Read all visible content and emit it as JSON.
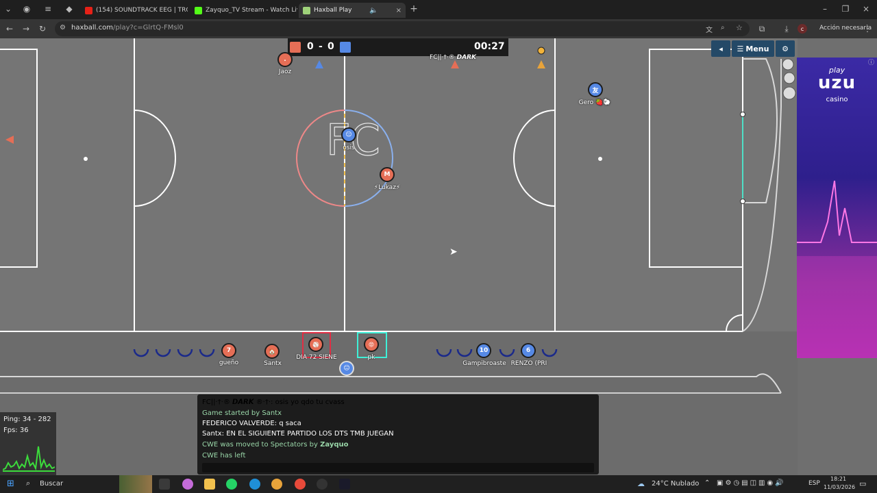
{
  "browser": {
    "tabs": [
      {
        "title": "(154) SOUNDTRACK EEG | TRO",
        "favicon_color": "#e62117"
      },
      {
        "title": "Zayquo_TV Stream - Watch Liv",
        "favicon_color": "#53fc18"
      },
      {
        "title": "Haxball Play",
        "favicon_color": "#9fd27a"
      }
    ],
    "url_host": "haxball.com",
    "url_path": "/play?c=GlrtQ-FMsl0",
    "profile_action": "Acción necesaria"
  },
  "scoreboard": {
    "red_score": "0",
    "separator": "-",
    "blue_score": "0",
    "time": "00:27",
    "red_color": "#e56e56",
    "blue_color": "#5689e5"
  },
  "menu": {
    "back_icon": "◂",
    "menu_label": "Menu",
    "gear_icon": "⚙"
  },
  "field": {
    "floor_text": "FC",
    "players_on_field": [
      {
        "name": "Jaoz",
        "team": "red",
        "avatar": "."
      },
      {
        "name": "FC||·†·® 𝘿𝘼𝙍𝙆",
        "team": "red",
        "avatar": ""
      },
      {
        "name": "Gero 🍓🐑",
        "team": "blue",
        "avatar": "友"
      },
      {
        "name": "osis",
        "team": "blue",
        "avatar": "😑"
      },
      {
        "name": "⚡Lukaz⚡",
        "team": "red",
        "avatar": "M"
      }
    ],
    "bench_red": [
      {
        "name": "gueño",
        "avatar": "7"
      },
      {
        "name": "Santx",
        "avatar": "🏠"
      },
      {
        "name": "DIA 72 SIENE",
        "avatar": "⚾"
      },
      {
        "name": "pk",
        "avatar": "😡"
      }
    ],
    "bench_blue": [
      {
        "name": "Gampibroaste",
        "avatar": "10"
      },
      {
        "name": "RENZO (PRI",
        "avatar": "6"
      }
    ],
    "spectator_avatar": "😑"
  },
  "ad": {
    "brand_line1": "play",
    "brand_line2": "uzu",
    "brand_line3": "casino"
  },
  "chat": [
    {
      "text": "FC||·†·® 𝘿𝘼𝙍𝙆 ®·†·: osis yo qdo tu cvass",
      "color": "#ffffff"
    },
    {
      "text": "Game started by Santx",
      "color": "#9ad7a9"
    },
    {
      "text": "FEDERICO VALVERDE: q saca",
      "color": "#ffffff"
    },
    {
      "text": "Santx: EN EL SIGUIENTE PARTIDO LOS DTS TMB JUEGAN",
      "color": "#ffffff"
    },
    {
      "text": "CWE was moved to Spectators by ",
      "color": "#9ad7a9",
      "bold_suffix": "Zayquo"
    },
    {
      "text": "CWE has left",
      "color": "#9ad7a9"
    }
  ],
  "stats": {
    "ping": "Ping: 34 - 282",
    "fps": "Fps: 36"
  },
  "taskbar": {
    "search": "Buscar",
    "weather": "24°C  Nublado",
    "lang": "ESP",
    "time": "18:21",
    "date": "11/03/2026"
  }
}
